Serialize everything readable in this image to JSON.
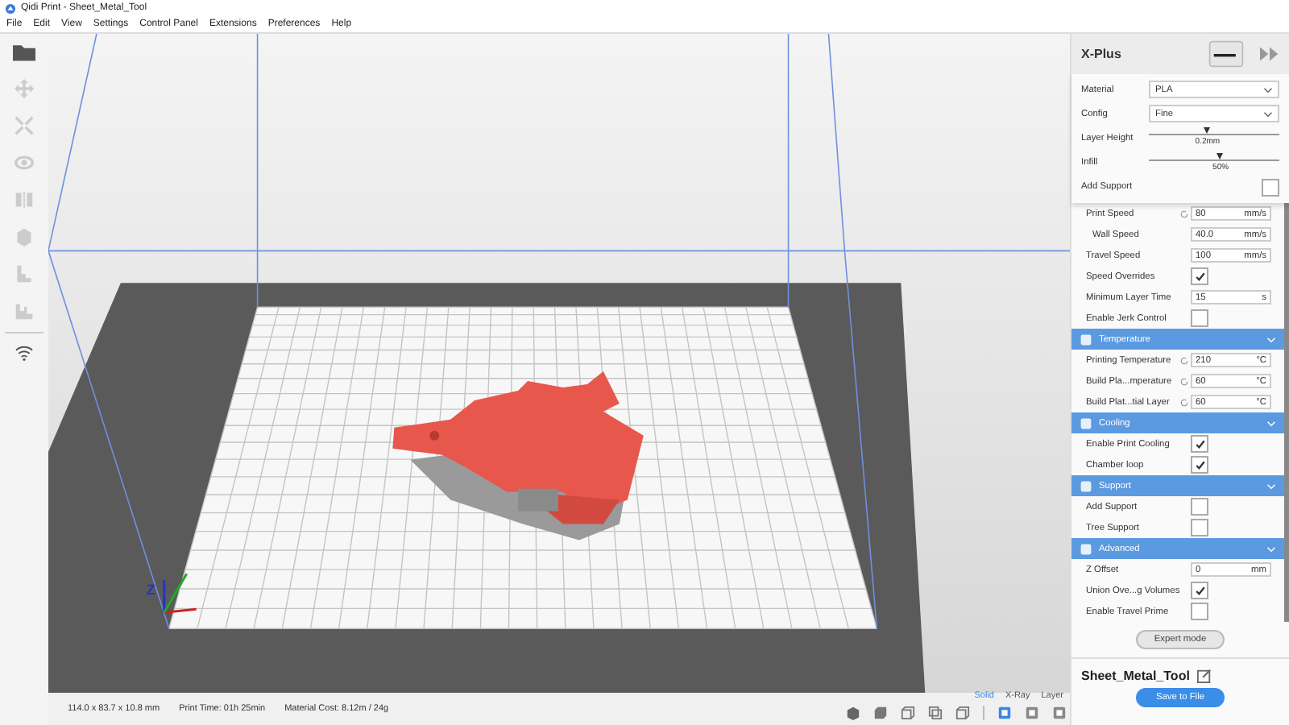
{
  "window": {
    "title": "Qidi Print - Sheet_Metal_Tool"
  },
  "menu": [
    "File",
    "Edit",
    "View",
    "Settings",
    "Control Panel",
    "Extensions",
    "Preferences",
    "Help"
  ],
  "printer": {
    "name": "X-Plus"
  },
  "quick_settings": {
    "material": {
      "label": "Material",
      "value": "PLA"
    },
    "config": {
      "label": "Config",
      "value": "Fine"
    },
    "layer_height": {
      "label": "Layer Height",
      "level": 0.45,
      "reading": "0.2mm"
    },
    "infill": {
      "label": "Infill",
      "level": 0.55,
      "reading": "50%"
    },
    "add_support": {
      "label": "Add Support",
      "checked": false
    }
  },
  "settings": [
    {
      "kind": "field",
      "label": "Print Speed",
      "value": "80",
      "unit": "mm/s",
      "resettable": true,
      "indented": false
    },
    {
      "kind": "field",
      "label": "Wall Speed",
      "value": "40.0",
      "unit": "mm/s",
      "resettable": false,
      "indented": true
    },
    {
      "kind": "field",
      "label": "Travel Speed",
      "value": "100",
      "unit": "mm/s",
      "resettable": false,
      "indented": false
    },
    {
      "kind": "checkbox",
      "label": "Speed Overrides",
      "checked": true
    },
    {
      "kind": "field",
      "label": "Minimum Layer Time",
      "value": "15",
      "unit": "s",
      "resettable": false,
      "indented": false
    },
    {
      "kind": "checkbox",
      "label": "Enable Jerk Control",
      "checked": false
    },
    {
      "kind": "section",
      "label": "Temperature"
    },
    {
      "kind": "field",
      "label": "Printing Temperature",
      "value": "210",
      "unit": "°C",
      "resettable": true,
      "indented": false
    },
    {
      "kind": "field",
      "label": "Build Pla...mperature",
      "value": "60",
      "unit": "°C",
      "resettable": true,
      "indented": false
    },
    {
      "kind": "field",
      "label": "Build Plat...tial Layer",
      "value": "60",
      "unit": "°C",
      "resettable": true,
      "indented": false
    },
    {
      "kind": "section",
      "label": "Cooling"
    },
    {
      "kind": "checkbox",
      "label": "Enable Print Cooling",
      "checked": true
    },
    {
      "kind": "checkbox",
      "label": "Chamber loop",
      "checked": true
    },
    {
      "kind": "section",
      "label": "Support"
    },
    {
      "kind": "checkbox",
      "label": "Add Support",
      "checked": false
    },
    {
      "kind": "checkbox",
      "label": "Tree Support",
      "checked": false
    },
    {
      "kind": "section",
      "label": "Advanced"
    },
    {
      "kind": "field",
      "label": "Z Offset",
      "value": "0",
      "unit": "mm",
      "resettable": false,
      "indented": false
    },
    {
      "kind": "checkbox",
      "label": "Union Ove...g Volumes",
      "checked": true
    },
    {
      "kind": "checkbox",
      "label": "Enable Travel Prime",
      "checked": false
    }
  ],
  "expert_button": "Expert mode",
  "axis_label": "Z",
  "model_name": "Sheet_Metal_Tool",
  "save_button": "Save to File",
  "status_bar": {
    "dimensions": "114.0 x 83.7 x 10.8 mm",
    "print_time": "Print Time: 01h 25min",
    "material_cost": "Material Cost: 8.12m / 24g"
  },
  "view_modes": [
    {
      "label": "Solid",
      "selected": true
    },
    {
      "label": "X-Ray",
      "selected": false
    },
    {
      "label": "Layer",
      "selected": false
    }
  ]
}
